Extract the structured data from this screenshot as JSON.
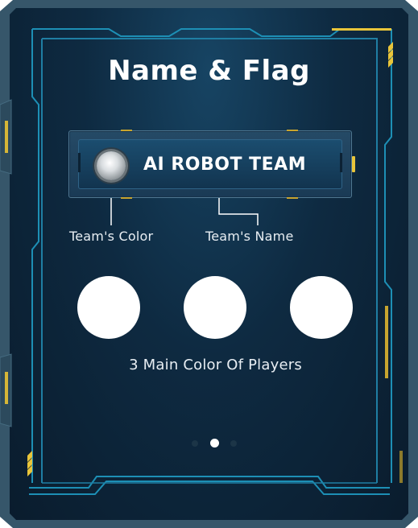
{
  "screen": {
    "title": "Name & Flag"
  },
  "team": {
    "name": "AI ROBOT TEAM"
  },
  "callouts": {
    "color_label": "Team's Color",
    "name_label": "Team's Name"
  },
  "players": {
    "caption": "3 Main Color Of Players",
    "colors": [
      "#ffffff",
      "#ffffff",
      "#ffffff"
    ]
  },
  "pagination": {
    "total_pages": 3,
    "current_page": 2
  },
  "theme": {
    "panel": "#0e2a41",
    "frame": "#36566a",
    "accent_line": "#1d8fb5",
    "accent_yellow": "#e9c53a",
    "text": "#ffffff"
  }
}
